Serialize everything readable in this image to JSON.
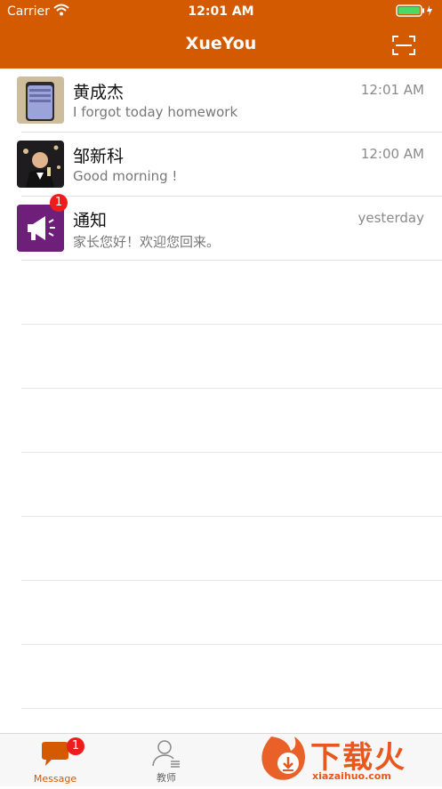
{
  "status_bar": {
    "carrier": "Carrier",
    "time": "12:01 AM"
  },
  "header": {
    "title": "XueYou"
  },
  "conversations": [
    {
      "name": "黄成杰",
      "time": "12:01 AM",
      "message": "I forgot today homework",
      "badge": ""
    },
    {
      "name": "邹新科",
      "time": "12:00 AM",
      "message": "Good morning !",
      "badge": ""
    },
    {
      "name": "通知",
      "time": "yesterday",
      "message": "家长您好！欢迎您回来。",
      "badge": "1"
    }
  ],
  "tabbar": {
    "tabs": [
      {
        "label": "Message",
        "badge": "1"
      },
      {
        "label": "教师"
      }
    ]
  },
  "watermark": {
    "text": "下载火",
    "site": "xiazaihuo.com"
  },
  "colors": {
    "brand": "#d35a00",
    "badge": "#f01b1b",
    "notice_bg": "#6d1f7a",
    "tab_active": "#d35a00"
  }
}
